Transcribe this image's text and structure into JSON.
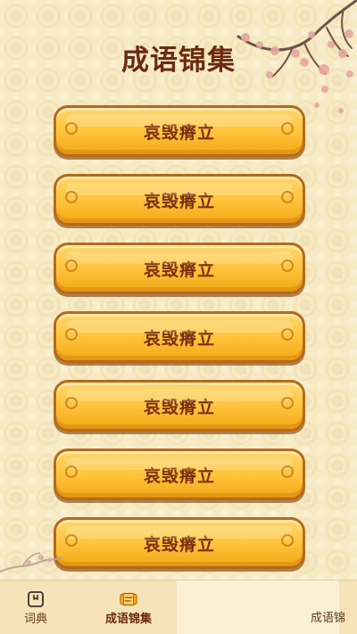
{
  "page": {
    "title": "成语锦集"
  },
  "idioms": [
    "哀毁瘠立",
    "哀毁瘠立",
    "哀毁瘠立",
    "哀毁瘠立",
    "哀毁瘠立",
    "哀毁瘠立",
    "哀毁瘠立"
  ],
  "tabs": {
    "dictionary": "词典",
    "collection": "成语锦集",
    "right_faded": "成语锦"
  },
  "icons": {
    "dictionary": "bookmark-book-icon",
    "collection": "scroll-icon"
  },
  "colors": {
    "background": "#f7ebc6",
    "button_fill": "#ffc53f",
    "button_border": "#b66a18",
    "title_text": "#6b2a12",
    "tabbar": "#f6e4b8"
  }
}
